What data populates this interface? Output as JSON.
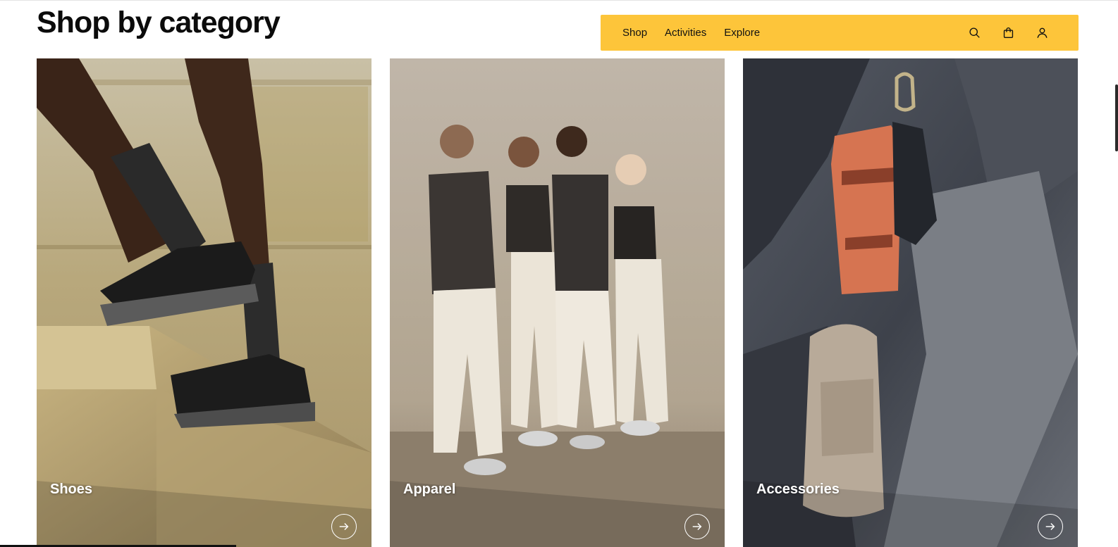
{
  "header": {
    "title": "Shop by category"
  },
  "navbar": {
    "background": "#fdc53a",
    "links": [
      {
        "label": "Shop"
      },
      {
        "label": "Activities"
      },
      {
        "label": "Explore"
      }
    ],
    "icons": [
      "search-icon",
      "shopping-bag-icon",
      "account-icon"
    ]
  },
  "categories": [
    {
      "label": "Shoes",
      "image": "runner-on-concrete-steps",
      "action_icon": "arrow-right-icon"
    },
    {
      "label": "Apparel",
      "image": "four-models-against-concrete-wall",
      "action_icon": "arrow-right-icon"
    },
    {
      "label": "Accessories",
      "image": "backpacks-hanging-on-rock",
      "action_icon": "arrow-right-icon"
    }
  ]
}
